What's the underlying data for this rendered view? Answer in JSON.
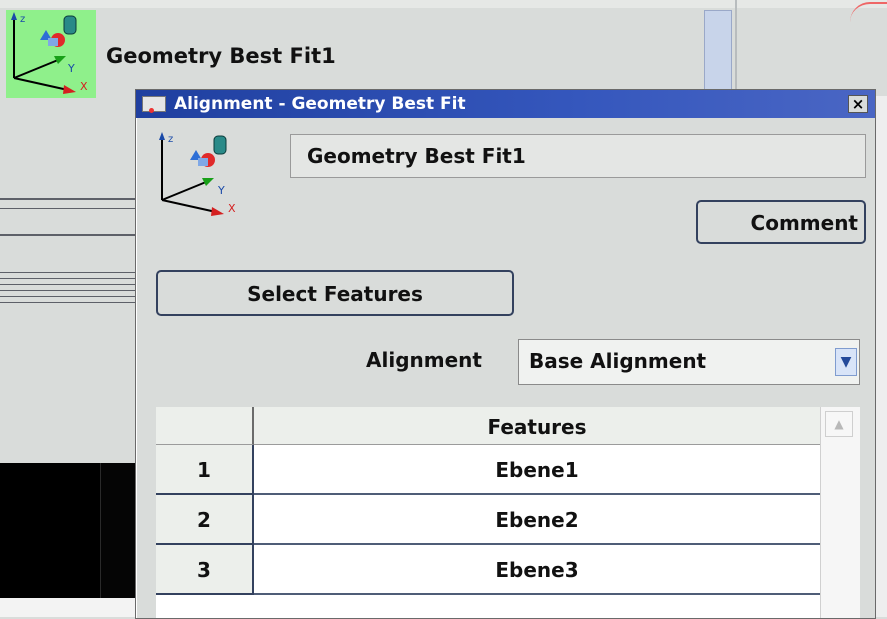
{
  "background": {
    "node_title": "Geometry Best Fit1"
  },
  "dialog": {
    "title": "Alignment - Geometry Best Fit",
    "close_label": "×",
    "name_value": "Geometry Best Fit1",
    "comment_label": "Comment",
    "select_features_label": "Select Features",
    "alignment_label": "Alignment",
    "alignment_value": "Base Alignment",
    "table": {
      "header": "Features",
      "rows": [
        {
          "num": "1",
          "feature": "Ebene1"
        },
        {
          "num": "2",
          "feature": "Ebene2"
        },
        {
          "num": "3",
          "feature": "Ebene3"
        }
      ]
    }
  },
  "icons": {
    "coord_axes": "coordinate-system-icon",
    "dropdown": "chevron-down-icon",
    "scroll_up": "chevron-up-icon",
    "close": "close-icon"
  },
  "colors": {
    "titlebar": "#1f3f9f",
    "icon_highlight": "#8ff08b"
  }
}
